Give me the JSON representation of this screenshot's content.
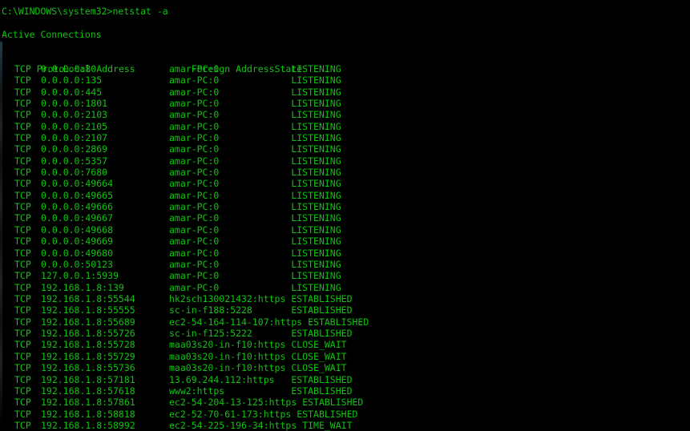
{
  "terminal": {
    "prompt_line": "C:\\WINDOWS\\system32>netstat -a",
    "section_title": "Active Connections",
    "columns": {
      "proto": "Proto",
      "local": "Local Address",
      "foreign": "Foreign Address",
      "state": "State"
    },
    "colors": {
      "foreground": "#0ec40e",
      "background": "#000000"
    },
    "connections": [
      {
        "proto": "TCP",
        "local": "0.0.0.0:80",
        "foreign": "amar-PC:0",
        "state": "LISTENING"
      },
      {
        "proto": "TCP",
        "local": "0.0.0.0:135",
        "foreign": "amar-PC:0",
        "state": "LISTENING"
      },
      {
        "proto": "TCP",
        "local": "0.0.0.0:445",
        "foreign": "amar-PC:0",
        "state": "LISTENING"
      },
      {
        "proto": "TCP",
        "local": "0.0.0.0:1801",
        "foreign": "amar-PC:0",
        "state": "LISTENING"
      },
      {
        "proto": "TCP",
        "local": "0.0.0.0:2103",
        "foreign": "amar-PC:0",
        "state": "LISTENING"
      },
      {
        "proto": "TCP",
        "local": "0.0.0.0:2105",
        "foreign": "amar-PC:0",
        "state": "LISTENING"
      },
      {
        "proto": "TCP",
        "local": "0.0.0.0:2107",
        "foreign": "amar-PC:0",
        "state": "LISTENING"
      },
      {
        "proto": "TCP",
        "local": "0.0.0.0:2869",
        "foreign": "amar-PC:0",
        "state": "LISTENING"
      },
      {
        "proto": "TCP",
        "local": "0.0.0.0:5357",
        "foreign": "amar-PC:0",
        "state": "LISTENING"
      },
      {
        "proto": "TCP",
        "local": "0.0.0.0:7680",
        "foreign": "amar-PC:0",
        "state": "LISTENING"
      },
      {
        "proto": "TCP",
        "local": "0.0.0.0:49664",
        "foreign": "amar-PC:0",
        "state": "LISTENING"
      },
      {
        "proto": "TCP",
        "local": "0.0.0.0:49665",
        "foreign": "amar-PC:0",
        "state": "LISTENING"
      },
      {
        "proto": "TCP",
        "local": "0.0.0.0:49666",
        "foreign": "amar-PC:0",
        "state": "LISTENING"
      },
      {
        "proto": "TCP",
        "local": "0.0.0.0:49667",
        "foreign": "amar-PC:0",
        "state": "LISTENING"
      },
      {
        "proto": "TCP",
        "local": "0.0.0.0:49668",
        "foreign": "amar-PC:0",
        "state": "LISTENING"
      },
      {
        "proto": "TCP",
        "local": "0.0.0.0:49669",
        "foreign": "amar-PC:0",
        "state": "LISTENING"
      },
      {
        "proto": "TCP",
        "local": "0.0.0.0:49680",
        "foreign": "amar-PC:0",
        "state": "LISTENING"
      },
      {
        "proto": "TCP",
        "local": "0.0.0.0:50123",
        "foreign": "amar-PC:0",
        "state": "LISTENING"
      },
      {
        "proto": "TCP",
        "local": "127.0.0.1:5939",
        "foreign": "amar-PC:0",
        "state": "LISTENING"
      },
      {
        "proto": "TCP",
        "local": "192.168.1.8:139",
        "foreign": "amar-PC:0",
        "state": "LISTENING"
      },
      {
        "proto": "TCP",
        "local": "192.168.1.8:55544",
        "foreign": "hk2sch130021432:https",
        "state": "ESTABLISHED"
      },
      {
        "proto": "TCP",
        "local": "192.168.1.8:55555",
        "foreign": "sc-in-f188:5228",
        "state": "ESTABLISHED"
      },
      {
        "proto": "TCP",
        "local": "192.168.1.8:55689",
        "foreign": "ec2-54-164-114-107:https",
        "state": "ESTABLISHED"
      },
      {
        "proto": "TCP",
        "local": "192.168.1.8:55726",
        "foreign": "sc-in-f125:5222",
        "state": "ESTABLISHED"
      },
      {
        "proto": "TCP",
        "local": "192.168.1.8:55728",
        "foreign": "maa03s20-in-f10:https",
        "state": "CLOSE_WAIT"
      },
      {
        "proto": "TCP",
        "local": "192.168.1.8:55729",
        "foreign": "maa03s20-in-f10:https",
        "state": "CLOSE_WAIT"
      },
      {
        "proto": "TCP",
        "local": "192.168.1.8:55736",
        "foreign": "maa03s20-in-f10:https",
        "state": "CLOSE_WAIT"
      },
      {
        "proto": "TCP",
        "local": "192.168.1.8:57181",
        "foreign": "13.69.244.112:https",
        "state": "ESTABLISHED"
      },
      {
        "proto": "TCP",
        "local": "192.168.1.8:57618",
        "foreign": "www2:https",
        "state": "ESTABLISHED"
      },
      {
        "proto": "TCP",
        "local": "192.168.1.8:57861",
        "foreign": "ec2-54-204-13-125:https",
        "state": "ESTABLISHED"
      },
      {
        "proto": "TCP",
        "local": "192.168.1.8:58818",
        "foreign": "ec2-52-70-61-173:https",
        "state": "ESTABLISHED"
      },
      {
        "proto": "TCP",
        "local": "192.168.1.8:58992",
        "foreign": "ec2-54-225-196-34:https",
        "state": "TIME_WAIT"
      }
    ]
  }
}
